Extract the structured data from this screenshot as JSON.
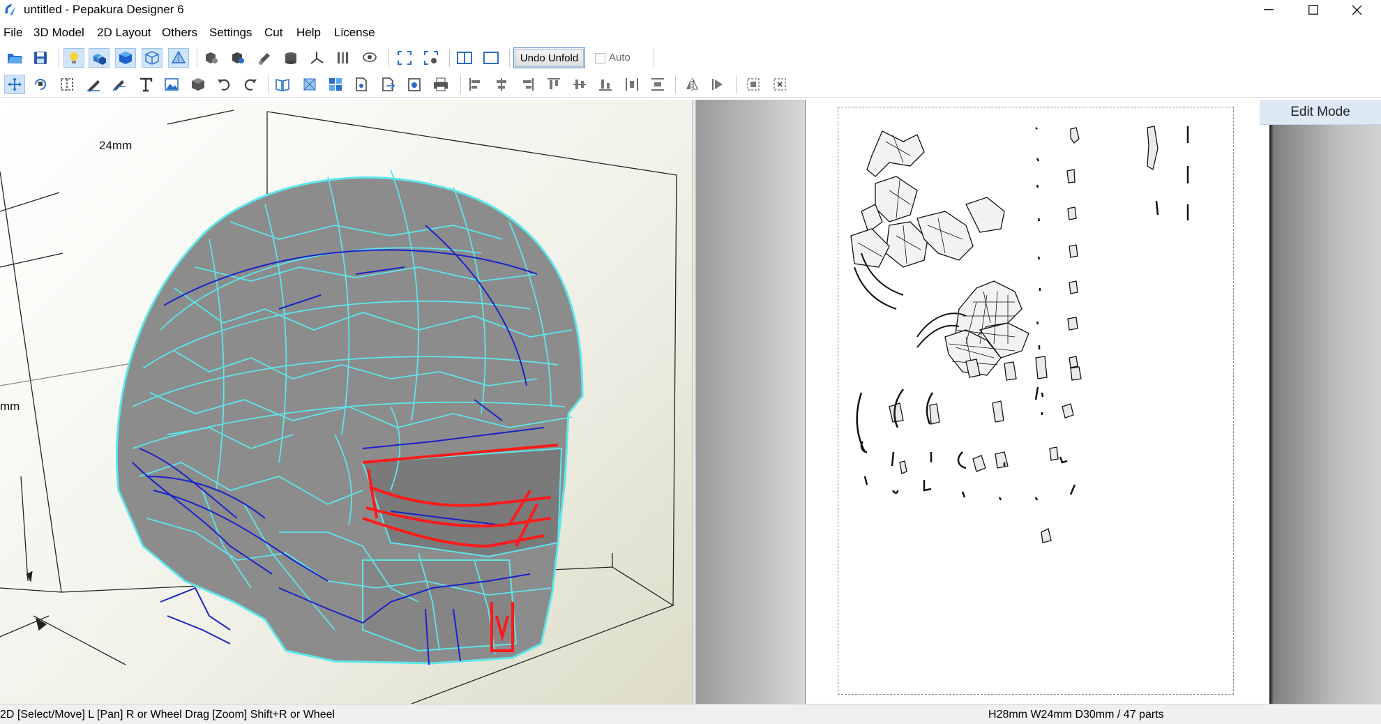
{
  "window": {
    "title": "untitled - Pepakura Designer 6",
    "controls": [
      "minimize",
      "maximize",
      "close"
    ]
  },
  "menu": [
    "File",
    "3D Model",
    "2D Layout",
    "Others",
    "Settings",
    "Cut",
    "Help",
    "License"
  ],
  "toolbar": {
    "undo_unfold_label": "Undo Unfold",
    "auto_label": "Auto",
    "auto_checked": false
  },
  "view3d": {
    "dim_width": "24mm",
    "dim_height_partial": "mm",
    "model": "helmet",
    "face_color": "#8a8a8a",
    "edge_color_mountain": "#5de6ea",
    "edge_color_valley": "#1a22c8",
    "selected_color": "#ff1a1a"
  },
  "view2d": {
    "mode_label": "Edit Mode"
  },
  "status": {
    "left": "2D [Select/Move] L [Pan] R or Wheel Drag [Zoom] Shift+R or Wheel",
    "right": "H28mm W24mm D30mm / 47 parts"
  },
  "colors": {
    "accent": "#cfe4f8",
    "icon_blue": "#2a6fc9"
  }
}
